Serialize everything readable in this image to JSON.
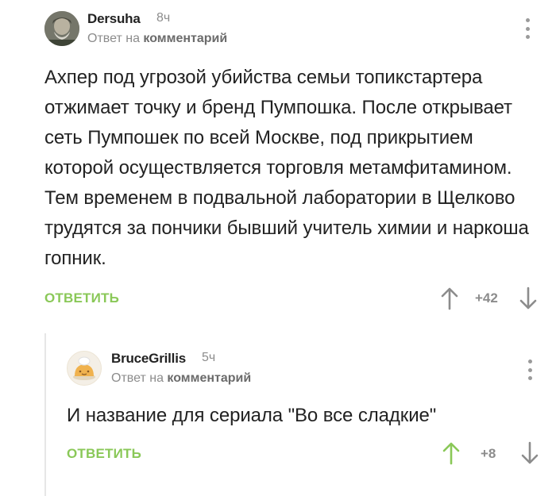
{
  "comments": [
    {
      "username": "Dersuha",
      "time": "8ч",
      "reply_prefix": "Ответ на",
      "reply_target": "комментарий",
      "text": "Ахпер под угрозой убийства семьи топикстартера отжимает точку и бренд Пумпошка. После открывает сеть Пумпошек по всей Москве, под прикрытием которой осуществляется торговля метамфитамином. Тем временем в подвальной лаборатории в Щелково трудятся за пончики бывший учитель химии и наркоша гопник.",
      "reply_label": "ОТВЕТИТЬ",
      "rating": "+42",
      "upvoted": false
    },
    {
      "username": "BruceGrillis",
      "time": "5ч",
      "reply_prefix": "Ответ на",
      "reply_target": "комментарий",
      "text": "И название для сериала \"Во все сладкие\"",
      "reply_label": "ОТВЕТИТЬ",
      "rating": "+8",
      "upvoted": true
    }
  ],
  "colors": {
    "accent_green": "#8ac858",
    "muted_gray": "#8c8c8c",
    "text": "#222222"
  },
  "icons": {
    "more": "more-vertical-icon",
    "up": "arrow-up-icon",
    "down": "arrow-down-icon"
  }
}
